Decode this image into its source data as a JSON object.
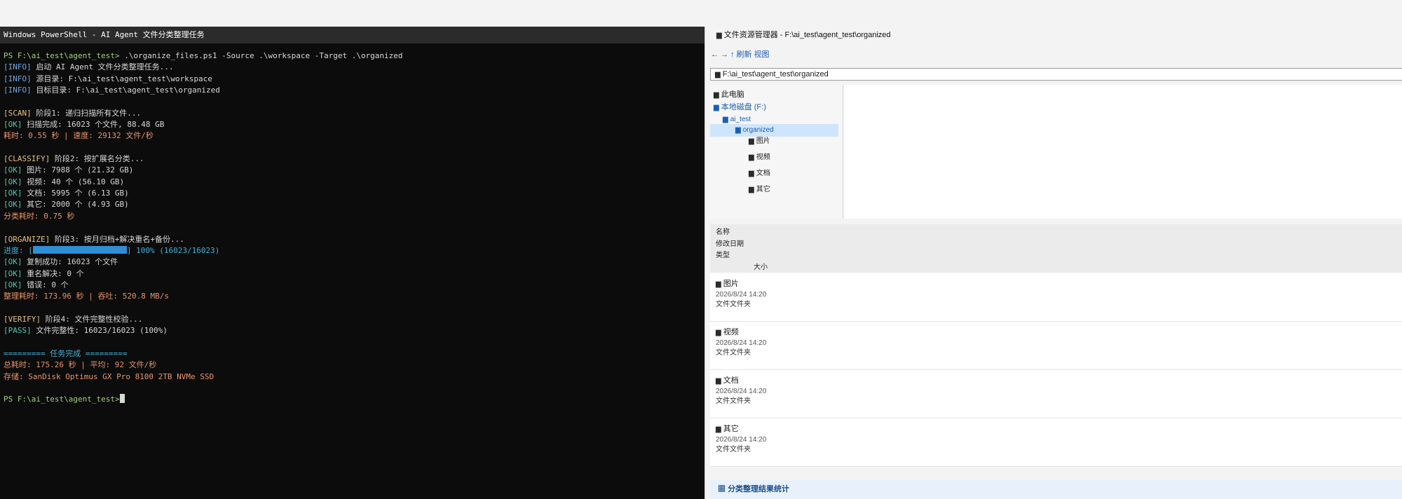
{
  "terminal": {
    "title": "Windows PowerShell - AI Agent 文件分类整理任务",
    "lines": [
      {
        "parts": [
          {
            "t": "PS F:\\ai_test\\agent_test> ",
            "c": "green"
          },
          {
            "t": ".\\organize_files.ps1 -Source .\\workspace -Target .\\organized",
            "c": "white"
          }
        ]
      },
      {
        "parts": [
          {
            "t": "[INFO]",
            "c": "blue"
          },
          {
            "t": " 启动 AI Agent 文件分类整理任务...",
            "c": "white"
          }
        ]
      },
      {
        "parts": [
          {
            "t": "[INFO]",
            "c": "blue"
          },
          {
            "t": " 源目录: F:\\ai_test\\agent_test\\workspace",
            "c": "white"
          }
        ]
      },
      {
        "parts": [
          {
            "t": "[INFO]",
            "c": "blue"
          },
          {
            "t": " 目标目录: F:\\ai_test\\agent_test\\organized",
            "c": "white"
          }
        ]
      },
      {
        "parts": []
      },
      {
        "parts": [
          {
            "t": "[SCAN]",
            "c": "yellow"
          },
          {
            "t": " 阶段1: 递归扫描所有文件...",
            "c": "white"
          }
        ]
      },
      {
        "parts": [
          {
            "t": "[OK]",
            "c": "teal"
          },
          {
            "t": " 扫描完成: 16023 个文件, 88.48 GB",
            "c": "white"
          }
        ]
      },
      {
        "parts": [
          {
            "t": "耗时: 0.55 秒 | 速度: 29132 文件/秒",
            "c": "orange"
          }
        ]
      },
      {
        "parts": []
      },
      {
        "parts": [
          {
            "t": "[CLASSIFY]",
            "c": "yellow"
          },
          {
            "t": " 阶段2: 按扩展名分类...",
            "c": "white"
          }
        ]
      },
      {
        "parts": [
          {
            "t": "[OK]",
            "c": "teal"
          },
          {
            "t": " 图片: 7988 个 (21.32 GB)",
            "c": "white"
          }
        ]
      },
      {
        "parts": [
          {
            "t": "[OK]",
            "c": "teal"
          },
          {
            "t": " 视频: 40 个 (56.10 GB)",
            "c": "white"
          }
        ]
      },
      {
        "parts": [
          {
            "t": "[OK]",
            "c": "teal"
          },
          {
            "t": " 文档: 5995 个 (6.13 GB)",
            "c": "white"
          }
        ]
      },
      {
        "parts": [
          {
            "t": "[OK]",
            "c": "teal"
          },
          {
            "t": " 其它: 2000 个 (4.93 GB)",
            "c": "white"
          }
        ]
      },
      {
        "parts": [
          {
            "t": "分类耗时: 0.75 秒",
            "c": "orange"
          }
        ]
      },
      {
        "parts": []
      },
      {
        "parts": [
          {
            "t": "[ORGANIZE]",
            "c": "yellow"
          },
          {
            "t": " 阶段3: 按月归档+解决重名+备份...",
            "c": "white"
          }
        ]
      },
      {
        "progress": true,
        "prefix": "进度: [",
        "suffix": "] 100% (16023/16023)",
        "c": "cyan"
      },
      {
        "parts": [
          {
            "t": "[OK]",
            "c": "teal"
          },
          {
            "t": " 复制成功: 16023 个文件",
            "c": "white"
          }
        ]
      },
      {
        "parts": [
          {
            "t": "[OK]",
            "c": "teal"
          },
          {
            "t": " 重名解决: 0 个",
            "c": "white"
          }
        ]
      },
      {
        "parts": [
          {
            "t": "[OK]",
            "c": "teal"
          },
          {
            "t": " 错误: 0 个",
            "c": "white"
          }
        ]
      },
      {
        "parts": [
          {
            "t": "整理耗时: 173.96 秒 | 吞吐: 520.8 MB/s",
            "c": "orange"
          }
        ]
      },
      {
        "parts": []
      },
      {
        "parts": [
          {
            "t": "[VERIFY]",
            "c": "yellow"
          },
          {
            "t": " 阶段4: 文件完整性校验...",
            "c": "white"
          }
        ]
      },
      {
        "parts": [
          {
            "t": "[PASS]",
            "c": "teal"
          },
          {
            "t": " 文件完整性: 16023/16023 (100%)",
            "c": "white"
          }
        ]
      },
      {
        "parts": []
      },
      {
        "parts": [
          {
            "t": "========= 任务完成 =========",
            "c": "cyan"
          }
        ]
      },
      {
        "parts": [
          {
            "t": "总耗时: 175.26 秒 | 平均: 92 文件/秒",
            "c": "orange"
          }
        ]
      },
      {
        "parts": [
          {
            "t": "存储: SanDisk Optimus GX Pro 8100 2TB NVMe SSD",
            "c": "orange"
          }
        ]
      },
      {
        "parts": []
      },
      {
        "prompt": true,
        "parts": [
          {
            "t": "PS F:\\ai_test\\agent_test>",
            "c": "green"
          }
        ]
      }
    ],
    "progress_fraction": 1.0
  },
  "explorer": {
    "title": "文件资源管理器 - F:\\ai_test\\agent_test\\organized",
    "toolbar": {
      "back": "←",
      "forward": "→",
      "up": "↑",
      "refresh": "刷新",
      "view": "视图"
    },
    "address": "F:\\ai_test\\agent_test\\organized",
    "tree": {
      "this_pc": "此电脑",
      "local_disk": "本地磁盘 (F:)",
      "ai_test": "ai_test",
      "organized": "organized",
      "children": [
        "图片",
        "视频",
        "文档",
        "其它"
      ]
    },
    "columns": {
      "name": "名称",
      "modified": "修改日期",
      "type": "类型",
      "size": "大小"
    },
    "rows": [
      {
        "name": "图片",
        "date": "2026/8/24 14:20",
        "type": "文件文件夹"
      },
      {
        "name": "视频",
        "date": "2026/8/24 14:20",
        "type": "文件文件夹"
      },
      {
        "name": "文档",
        "date": "2026/8/24 14:20",
        "type": "文件文件夹"
      },
      {
        "name": "其它",
        "date": "2026/8/24 14:20",
        "type": "文件文件夹"
      }
    ],
    "stats_label": "分类整理结果统计",
    "folder_icon": "▆",
    "chart_icon": "▦",
    "colors": {
      "accent": "#1a5fb4",
      "selection": "#cfe5fb"
    }
  }
}
